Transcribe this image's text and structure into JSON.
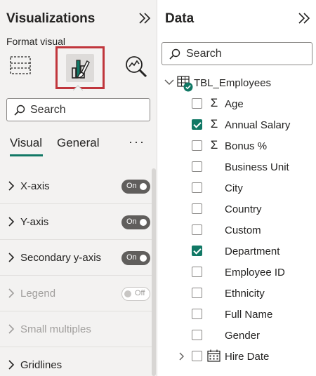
{
  "visualizations": {
    "title": "Visualizations",
    "format_label": "Format visual",
    "search_placeholder": "Search",
    "tabs": [
      {
        "label": "Visual",
        "active": true
      },
      {
        "label": "General",
        "active": false
      }
    ],
    "more_label": "···",
    "sections": [
      {
        "label": "X-axis",
        "toggle": "On",
        "disabled": false
      },
      {
        "label": "Y-axis",
        "toggle": "On",
        "disabled": false
      },
      {
        "label": "Secondary y-axis",
        "toggle": "On",
        "disabled": false
      },
      {
        "label": "Legend",
        "toggle": "Off",
        "disabled": true
      },
      {
        "label": "Small multiples",
        "toggle": null,
        "disabled": true
      },
      {
        "label": "Gridlines",
        "toggle": null,
        "disabled": false
      }
    ]
  },
  "data": {
    "title": "Data",
    "search_placeholder": "Search",
    "table": {
      "name": "TBL_Employees"
    },
    "fields": [
      {
        "name": "Age",
        "type": "sum",
        "checked": false
      },
      {
        "name": "Annual Salary",
        "type": "sum",
        "checked": true
      },
      {
        "name": "Bonus %",
        "type": "sum",
        "checked": false
      },
      {
        "name": "Business Unit",
        "type": "text",
        "checked": false
      },
      {
        "name": "City",
        "type": "text",
        "checked": false
      },
      {
        "name": "Country",
        "type": "text",
        "checked": false
      },
      {
        "name": "Custom",
        "type": "text",
        "checked": false
      },
      {
        "name": "Department",
        "type": "text",
        "checked": true
      },
      {
        "name": "Employee ID",
        "type": "text",
        "checked": false
      },
      {
        "name": "Ethnicity",
        "type": "text",
        "checked": false
      },
      {
        "name": "Full Name",
        "type": "text",
        "checked": false
      },
      {
        "name": "Gender",
        "type": "text",
        "checked": false
      },
      {
        "name": "Hire Date",
        "type": "date",
        "checked": false
      }
    ]
  },
  "colors": {
    "accent": "#117865",
    "highlight_box": "#c0363c",
    "pane_bg": "#f3f2f1"
  },
  "icons": {
    "sum": "Σ"
  }
}
